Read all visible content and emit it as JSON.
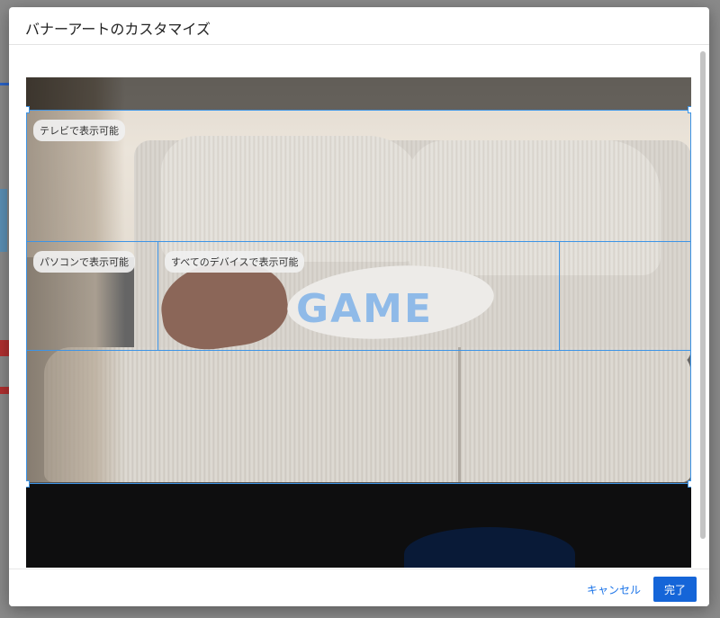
{
  "dialog": {
    "title": "バナーアートのカスタマイズ",
    "cancel_label": "キャンセル",
    "done_label": "完了"
  },
  "image": {
    "overlay_text": "GAME"
  },
  "guides": {
    "tv_label": "テレビで表示可能",
    "pc_label": "パソコンで表示可能",
    "all_devices_label": "すべてのデバイスで表示可能"
  },
  "colors": {
    "accent": "#1565d8",
    "guide": "#3d94e6"
  }
}
